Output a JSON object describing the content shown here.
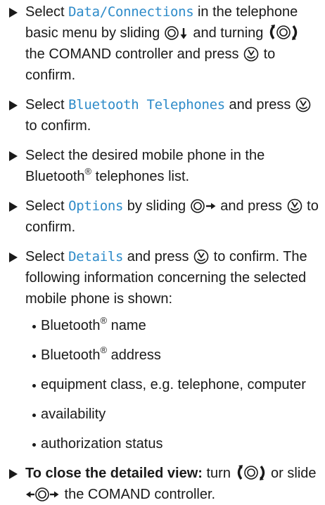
{
  "steps": [
    {
      "pre": "Select ",
      "menu": "Data/Connections",
      "mid1": " in the telephone basic menu by sliding ",
      "mid2": " and turning ",
      "mid3": " the COMAND controller and press ",
      "post": " to confirm."
    },
    {
      "pre": "Select ",
      "menu": "Bluetooth Telephones",
      "mid": " and press ",
      "post": " to confirm."
    },
    {
      "pre": "Select the desired mobile phone in the Bluetooth",
      "reg": "®",
      "post": " telephones list."
    },
    {
      "pre": "Select ",
      "menu": "Options",
      "mid1": " by sliding ",
      "mid2": " and press ",
      "post": " to confirm."
    },
    {
      "pre": "Select ",
      "menu": "Details",
      "mid": " and press ",
      "post": " to confirm. The following information concerning the selected mobile phone is shown:",
      "bullets": [
        {
          "text": "Bluetooth",
          "reg": "®",
          "rest": " name"
        },
        {
          "text": "Bluetooth",
          "reg": "®",
          "rest": " address"
        },
        {
          "text": "equipment class, e.g. telephone, computer"
        },
        {
          "text": "availability"
        },
        {
          "text": "authorization status"
        }
      ]
    },
    {
      "bold": "To close the detailed view:",
      "mid1": " turn ",
      "mid2": " or slide ",
      "post": " the COMAND controller."
    }
  ],
  "icons": {
    "controller": "comand-controller-icon",
    "slide_down": "slide-down-icon",
    "slide_right": "slide-right-icon",
    "slide_left_right": "slide-left-right-icon",
    "turn": "turn-controller-icon",
    "press": "press-controller-icon"
  }
}
